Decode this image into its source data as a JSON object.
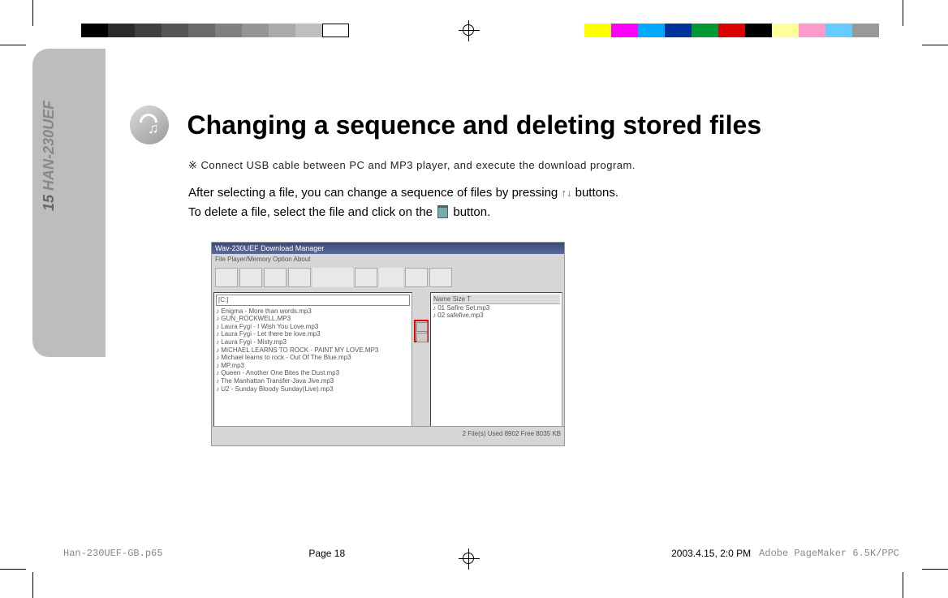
{
  "sideTab": {
    "num": "15",
    "model": "HAN-230UEF"
  },
  "heading": "Changing a sequence and deleting stored files",
  "note": "※ Connect USB cable between PC and MP3 player, and execute the download program.",
  "body1a": "After selecting a file, you can change a sequence of files by pressing ",
  "body1b": " buttons.",
  "body2a": "To delete a file, select the file and click on the ",
  "body2b": " button.",
  "shot": {
    "title": "Wav-230UEF Download Manager",
    "menu": "File   Player/Memory   Option   About",
    "dropdown": "[C:]",
    "files": [
      "Enigma - More than words.mp3",
      "GUN_ROCKWELL.MP3",
      "Laura Fygi - I Wish You Love.mp3",
      "Laura Fygi - Let there be love.mp3",
      "Laura Fygi - Misty.mp3",
      "MICHAEL LEARNS TO ROCK - PAINT MY LOVE.MP3",
      "Michael learns to rock - Out Of The Blue.mp3",
      "MP.mp3",
      "Queen - Another One Bites the Dust.mp3",
      "The Manhattan Transfer-Java Jive.mp3",
      "U2 - Sunday Bloody Sunday(Live).mp3"
    ],
    "rightHeader": "Name                                    Size   T",
    "rightFiles": [
      "01 Safire Set.mp3",
      "02 safefive.mp3"
    ],
    "status": "2 File(s)  Used 8902   Free 8035 KB"
  },
  "footer": {
    "file": "Han-230UEF-GB.p65",
    "page": "Page 18",
    "date": "2003.4.15, 2:0 PM",
    "app": "Adobe PageMaker 6.5K/PPC"
  },
  "colors": {
    "bar1": [
      "#000",
      "#333",
      "#555",
      "#777",
      "#999",
      "#aaa",
      "#bbb",
      "#ccc",
      "#ddd",
      "#fff"
    ],
    "bar2": [
      "#ff0",
      "#f0f",
      "#0ff",
      "#00a",
      "#0a0",
      "#d00",
      "#000",
      "#ff9",
      "#f9c",
      "#6cf",
      "#999"
    ]
  }
}
